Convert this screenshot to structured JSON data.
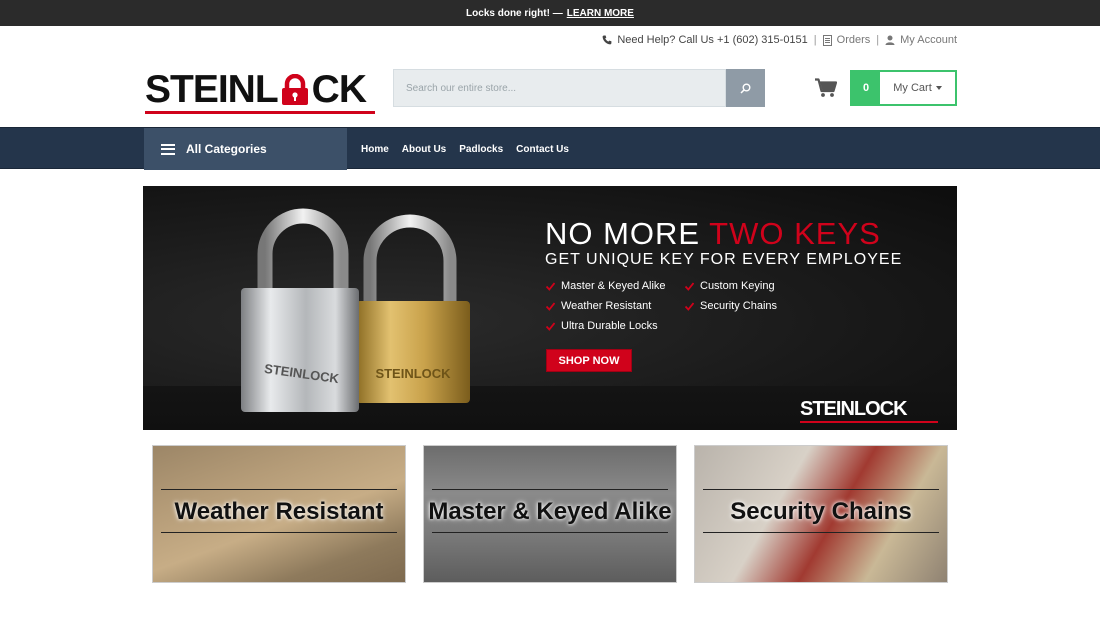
{
  "topbar": {
    "message": "Locks done right! —",
    "link": "LEARN MORE"
  },
  "utility": {
    "help": "Need Help? Call Us +1 (602) 315-0151",
    "orders": "Orders",
    "account": "My Account"
  },
  "logo": {
    "text_left": "STEINL",
    "text_right": "CK",
    "alt": "STEINLOCK"
  },
  "search": {
    "placeholder": "Search our entire store..."
  },
  "cart": {
    "count": "0",
    "label": "My Cart"
  },
  "nav": {
    "all_categories": "All Categories",
    "links": [
      "Home",
      "About Us",
      "Padlocks",
      "Contact Us"
    ]
  },
  "hero": {
    "headline_white": "NO MORE ",
    "headline_red": "TWO KEYS",
    "subheadline": "GET UNIQUE KEY FOR EVERY EMPLOYEE",
    "features": [
      "Master & Keyed Alike",
      "Custom Keying",
      "Weather Resistant",
      "Security Chains",
      "Ultra Durable Locks"
    ],
    "cta": "SHOP NOW",
    "logo": "STEINLOCK",
    "lock_brand": "STEINLOCK"
  },
  "categories": [
    {
      "title": "Weather Resistant"
    },
    {
      "title": "Master & Keyed Alike"
    },
    {
      "title": "Security Chains"
    }
  ],
  "colors": {
    "brand_red": "#d0021b",
    "nav_bg": "#24354b",
    "cart_green": "#3cc36c"
  }
}
